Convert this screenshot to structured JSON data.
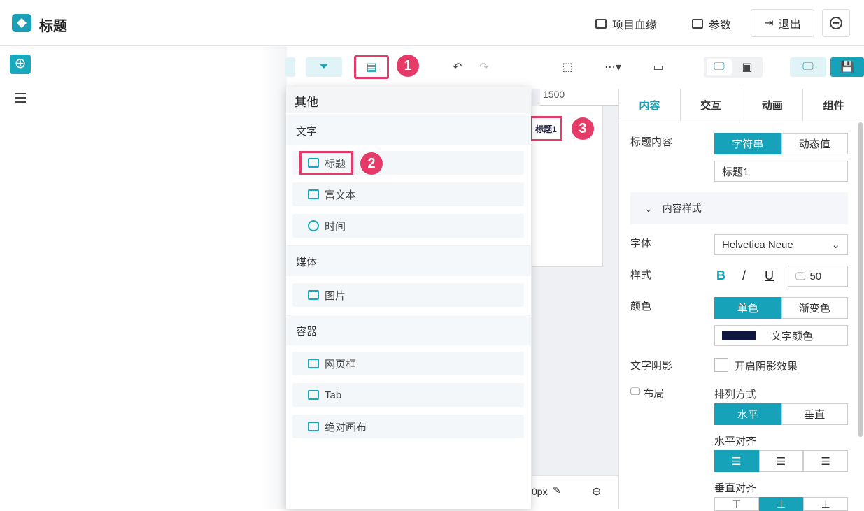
{
  "header": {
    "title": "标题",
    "actions": {
      "lineage": "项目血缘",
      "params": "参数",
      "exit": "退出"
    },
    "more_icon": "ellipsis-icon"
  },
  "badges": {
    "b1": "1",
    "b2": "2",
    "b3": "3"
  },
  "canvas": {
    "ruler_label": "1500",
    "element_label": "标题1",
    "bottom_text": "0px"
  },
  "component_menu": {
    "header": "其他",
    "categories": {
      "text": {
        "label": "文字",
        "items": [
          "标题",
          "富文本",
          "时间"
        ]
      },
      "media": {
        "label": "媒体",
        "items": [
          "图片"
        ]
      },
      "container": {
        "label": "容器",
        "items": [
          "网页框",
          "Tab",
          "绝对画布"
        ]
      }
    }
  },
  "properties": {
    "tabs": [
      "内容",
      "交互",
      "动画",
      "组件"
    ],
    "title_content": {
      "label": "标题内容",
      "options": [
        "字符串",
        "动态值"
      ],
      "value": "标题1"
    },
    "content_style": {
      "label": "内容样式"
    },
    "font": {
      "label": "字体",
      "value": "Helvetica Neue"
    },
    "style": {
      "label": "样式",
      "bold": "B",
      "italic": "/",
      "underline": "U",
      "size": "50"
    },
    "color": {
      "label": "颜色",
      "options": [
        "单色",
        "渐变色"
      ],
      "swatch_label": "文字颜色",
      "swatch_color": "#0f1640"
    },
    "shadow": {
      "label": "文字阴影",
      "checkbox_label": "开启阴影效果"
    },
    "layout": {
      "label": "布局",
      "arrangement": {
        "label": "排列方式",
        "options": [
          "水平",
          "垂直"
        ]
      },
      "h_align": {
        "label": "水平对齐"
      },
      "v_align": {
        "label": "垂直对齐"
      }
    }
  },
  "colors": {
    "accent": "#16a3b9",
    "highlight": "#e63a68"
  }
}
